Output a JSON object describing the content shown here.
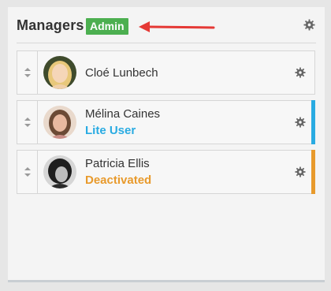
{
  "panel": {
    "title": "Managers",
    "badge": "Admin",
    "badge_color": "#4caf50",
    "settings_icon": "gear-icon"
  },
  "managers": [
    {
      "name": "Cloé Lunbech",
      "status": "",
      "status_color": "",
      "accent_color": ""
    },
    {
      "name": "Mélina Caines",
      "status": "Lite User",
      "status_color": "#29abe2",
      "accent_color": "#29abe2"
    },
    {
      "name": "Patricia Ellis",
      "status": "Deactivated",
      "status_color": "#e89a2c",
      "accent_color": "#e89a2c"
    }
  ],
  "icons": {
    "drag": "drag-handle-icon",
    "settings": "gear-icon",
    "annotation": "arrow-icon"
  }
}
